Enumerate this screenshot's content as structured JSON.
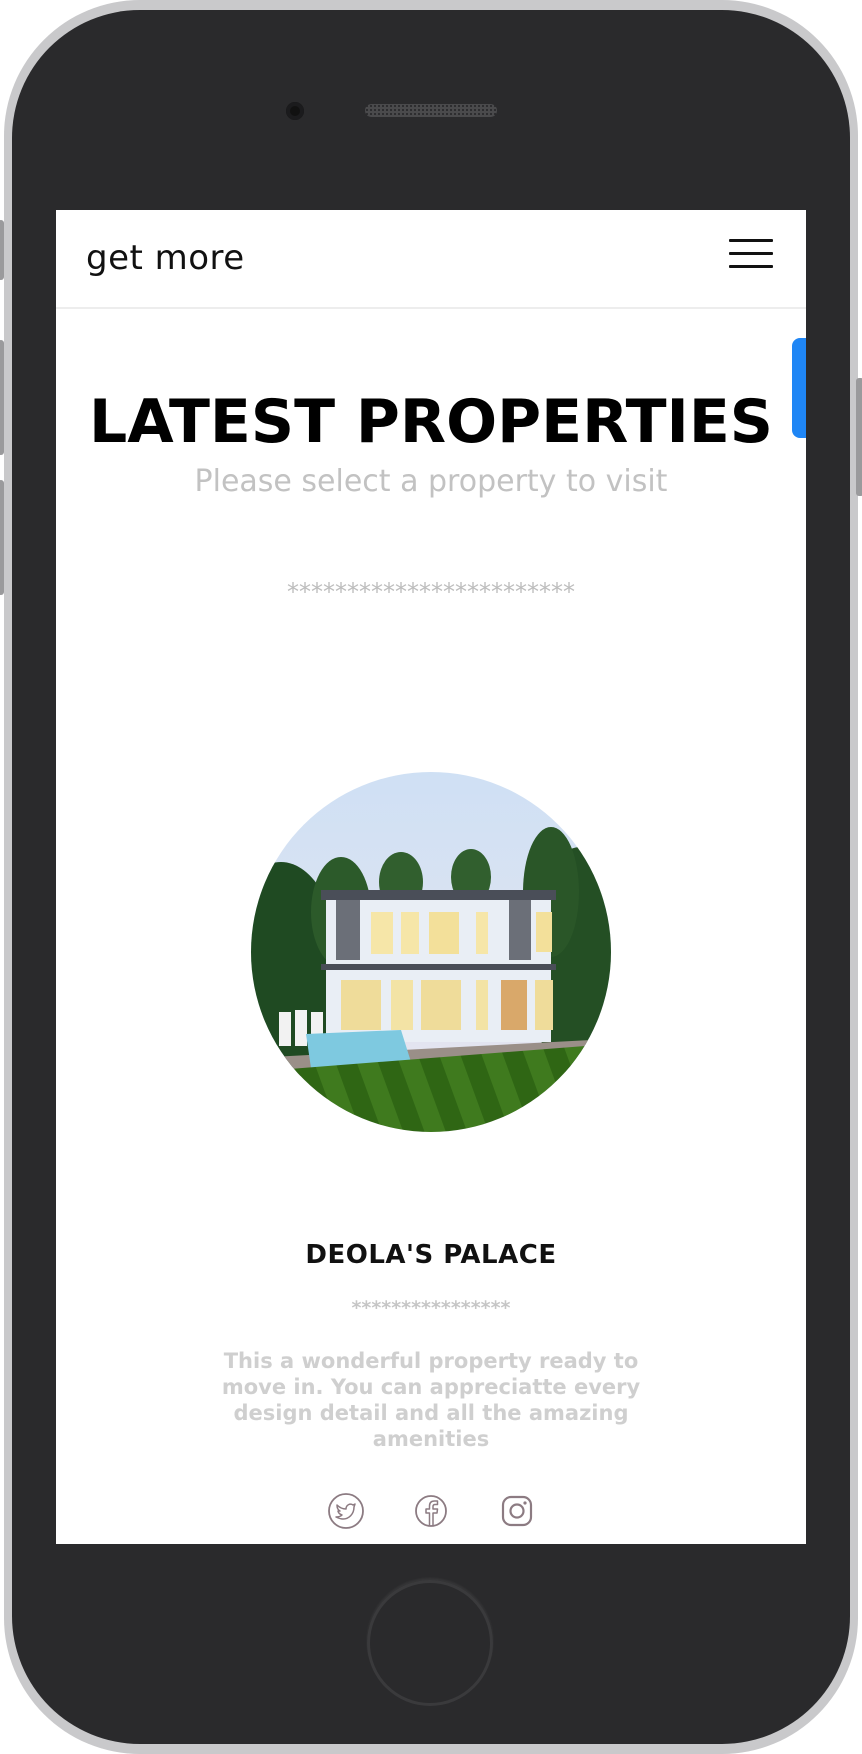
{
  "navbar": {
    "brand": "get more",
    "menu_icon": "hamburger-menu-icon"
  },
  "hero": {
    "title": "LATEST PROPERTIES",
    "subtitle": "Please select a property to visit",
    "divider": "************************"
  },
  "property": {
    "name": "DEOLA'S PALACE",
    "divider": "****************",
    "description": "This a wonderful property ready to move in. You can appreciatte every design detail and all the amazing amenities"
  },
  "socials": [
    {
      "icon": "twitter-icon"
    },
    {
      "icon": "facebook-icon"
    },
    {
      "icon": "instagram-icon"
    }
  ],
  "colors": {
    "accent_tab": "#1f86f5",
    "social_icon": "#8c7b82",
    "muted_text": "#c2c2c2"
  }
}
